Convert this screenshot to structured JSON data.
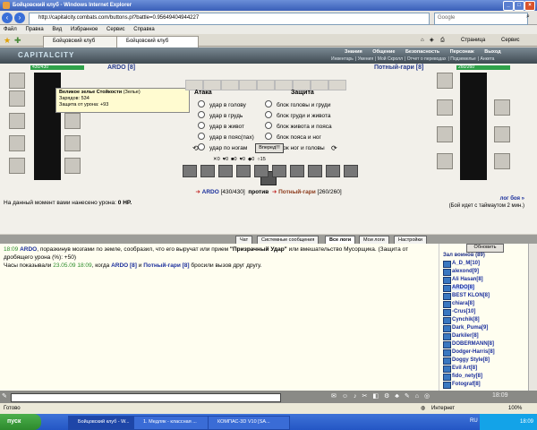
{
  "window": {
    "title": "Бойцовский клуб - Windows Internet Explorer"
  },
  "address": {
    "url": "http://capitalcity.combats.com/buttons.pl?battle=0.95649404944227",
    "search_placeholder": "Google"
  },
  "menu": [
    "Файл",
    "Правка",
    "Вид",
    "Избранное",
    "Сервис",
    "Справка"
  ],
  "tabs": [
    "Бойцовский клуб",
    "Бойцовский клуб"
  ],
  "tab_tools": {
    "page": "Страница",
    "service": "Сервис"
  },
  "game": {
    "logo": "CAPITALCITY",
    "nav": [
      "Знания",
      "Общение",
      "Безопасность",
      "Персонаж",
      "Выход"
    ],
    "subnav": [
      "Инвентарь",
      "Умения",
      "Мой Скролл",
      "Отчет о переводах",
      "Подземелье",
      "Анкета"
    ]
  },
  "player": {
    "name": "ARDO [8]",
    "hp": "430/430"
  },
  "enemy": {
    "name": "Потный-гари [8]",
    "hp": "260/260"
  },
  "tooltip": {
    "title": "Великое зелье Стойкости",
    "line1": "Зарядов: 534",
    "line2": "Защита от урона: +93",
    "suffix": "(Зелье)"
  },
  "attack": {
    "header": "Атака",
    "options": [
      "удар в голову",
      "удар в грудь",
      "удар в живот",
      "удар в пояс(пах)",
      "удар по ногам"
    ]
  },
  "defense": {
    "header": "Защита",
    "options": [
      "блок головы и груди",
      "блок груди и живота",
      "блок живота и пояса",
      "блок пояса и ног",
      "блок ног и головы"
    ]
  },
  "go_button": "Вперед!!!",
  "counters": [
    "0",
    "0",
    "0",
    "0",
    "0",
    "15"
  ],
  "versus": {
    "left": "ARDO",
    "left_hp": "[430/430]",
    "mid": "против",
    "right": "Потный-гари",
    "right_hp": "[260/260]"
  },
  "damage_text": "На данный момент вами нанесено урона:",
  "damage_value": "0 HP.",
  "battle_log": {
    "link": "лог боя »",
    "info": "(Бой идет с таймаутом 2 мин.)"
  },
  "lower_tabs": [
    "Чат",
    "Системные сообщения",
    "Все логи",
    "Мои логи",
    "Настройки"
  ],
  "chat_lines": [
    {
      "time": "18:09",
      "who": "ARDO",
      "text": ", поразкинув мозгами по земле, сообразил, что его выручат или прием",
      "quote": "\"Призрачный Удар\"",
      "rest": "или вмешательство Мусорщика. (Защита от дробящего урона (%): +50)"
    },
    {
      "text": "Часы показывали",
      "date": "23.05.09 18:09",
      "rest1": ", когда",
      "p1": "ARDO [8]",
      "mid": "и",
      "p2": "Потный-гари [8]",
      "rest2": "бросили вызов друг другу."
    }
  ],
  "sidebar": {
    "refresh": "Обновить",
    "head": "Зал воинов (89)",
    "warriors": [
      "A_D_M[10]",
      "alexond[9]",
      "Ali Hasan[8]",
      "ARDO[8]",
      "BEST KLON[8]",
      "chiara[8]",
      "-Crus[10]",
      "Cynchik[8]",
      "Dark_Puma[9]",
      "Darkiler[8]",
      "DOBERMANN[8]",
      "Dodger-Harris[8]",
      "Doggy Style[8]",
      "Evil Art[8]",
      "fido_nety[8]",
      "Fotograf[8]"
    ]
  },
  "clock": "18:09",
  "status": {
    "left": "Готово",
    "zone": "Интернет",
    "zoom": "100%"
  },
  "taskbar": {
    "start": "пуск",
    "tasks": [
      "Бойцовский клуб - W...",
      "1. Медляк - классная ...",
      "КОМПАС-3D V10 [SA..."
    ],
    "lang": "RU",
    "time": "18:09"
  },
  "colors": {
    "accent": "#1b2f9c",
    "enemy": "#8b3a1a",
    "hp_green": "#2fa24a",
    "time_green": "#2a8c2a"
  }
}
